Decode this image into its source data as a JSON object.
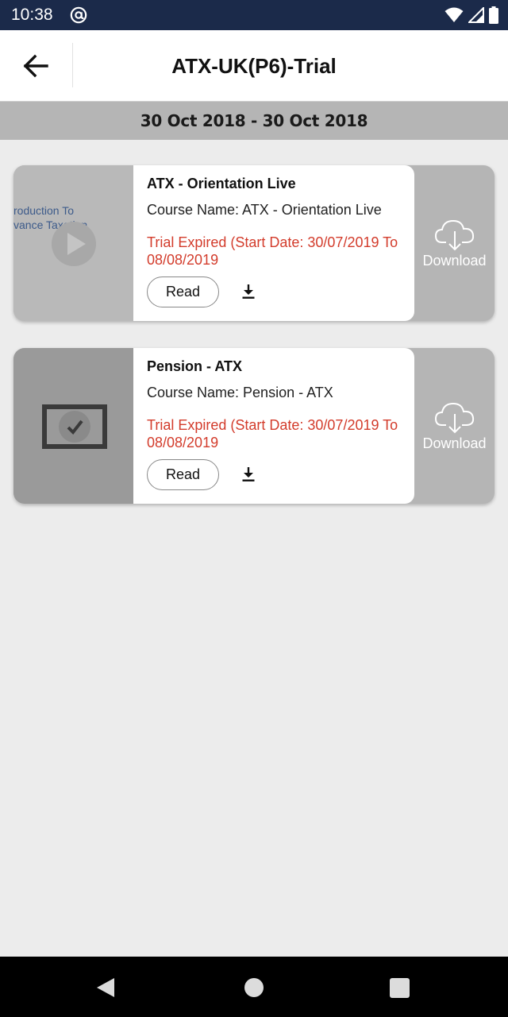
{
  "status_bar": {
    "time": "10:38",
    "icons": [
      "at-sign-icon",
      "wifi-icon",
      "signal-icon",
      "battery-icon"
    ]
  },
  "app_bar": {
    "title": "ATX-UK(P6)-Trial",
    "back_icon": "arrow-left-icon"
  },
  "date_range": "30 Oct 2018 - 30 Oct 2018",
  "courses": [
    {
      "title": "ATX - Orientation Live",
      "course_name": "Course Name: ATX - Orientation Live",
      "trial_status": "Trial Expired (Start Date: 30/07/2019 To 08/08/2019",
      "read_label": "Read",
      "download_label": "Download",
      "thumbnail_text": [
        "roduction To",
        "vance Taxation"
      ],
      "thumbnail_icon": "play-icon"
    },
    {
      "title": "Pension - ATX",
      "course_name": "Course Name: Pension - ATX",
      "trial_status": "Trial Expired (Start Date: 30/07/2019 To 08/08/2019",
      "read_label": "Read",
      "download_label": "Download",
      "thumbnail_icon": "video-frame-icon"
    }
  ],
  "nav_bar": {
    "icons": [
      "nav-back-icon",
      "nav-home-icon",
      "nav-recents-icon"
    ]
  },
  "colors": {
    "status_bar": "#1b2a4a",
    "date_bar": "#b5b5b5",
    "trial_expired": "#d33c2c",
    "background": "#ececec"
  }
}
